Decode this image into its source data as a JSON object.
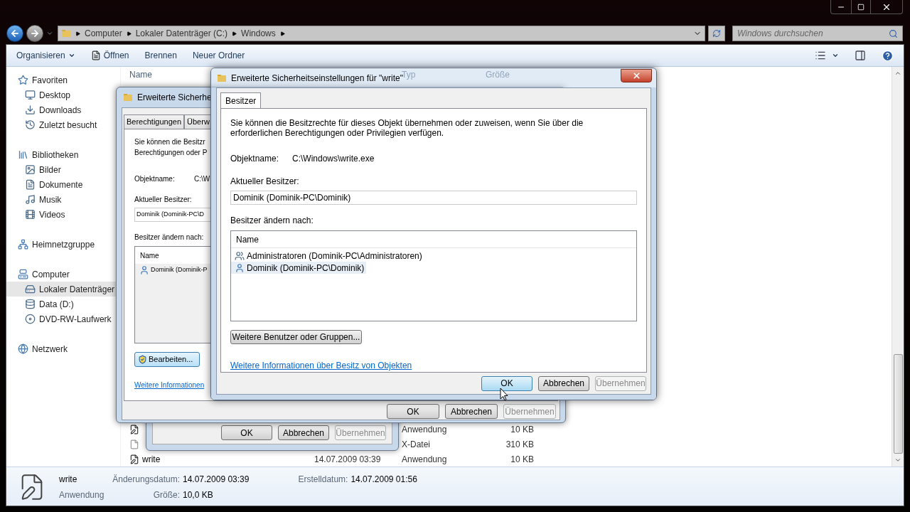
{
  "explorer": {
    "breadcrumb": [
      "Computer",
      "Lokaler Datenträger (C:)",
      "Windows"
    ],
    "search": {
      "placeholder": "Windows durchsuchen"
    },
    "toolbar": [
      {
        "label": "Organisieren",
        "kind": "menu"
      },
      {
        "label": "Öffnen",
        "kind": "icon"
      },
      {
        "label": "Brennen",
        "kind": "plain"
      },
      {
        "label": "Neuer Ordner",
        "kind": "plain"
      }
    ],
    "sidebar": [
      {
        "label": "Favoriten",
        "kind": "star",
        "items": [
          {
            "label": "Desktop",
            "kind": "desktop",
            "selected": false
          },
          {
            "label": "Downloads",
            "kind": "download",
            "selected": false
          },
          {
            "label": "Zuletzt besucht",
            "kind": "recent",
            "selected": false
          }
        ]
      },
      {
        "label": "Bibliotheken",
        "kind": "library",
        "items": [
          {
            "label": "Bilder",
            "kind": "image",
            "selected": false
          },
          {
            "label": "Dokumente",
            "kind": "document",
            "selected": false
          },
          {
            "label": "Musik",
            "kind": "music",
            "selected": false
          },
          {
            "label": "Videos",
            "kind": "video",
            "selected": false
          }
        ]
      },
      {
        "label": "Heimnetzgruppe",
        "kind": "homegroup"
      },
      {
        "label": "Computer",
        "kind": "computer",
        "items": [
          {
            "label": "Lokaler Datenträger",
            "kind": "drive",
            "selected": true
          },
          {
            "label": "Data (D:)",
            "kind": "data",
            "selected": false
          },
          {
            "label": "DVD-RW-Laufwerk",
            "kind": "dvd",
            "selected": false
          }
        ]
      },
      {
        "label": "Netzwerk",
        "kind": "network"
      }
    ],
    "file_list": {
      "columns": [
        "Name",
        "Typ",
        "Größe"
      ],
      "rows": [
        {
          "kind": "app",
          "type": "Anwendung",
          "size": "10 KB"
        },
        {
          "kind": "file",
          "type": "X-Datei",
          "size": "310 KB"
        },
        {
          "kind": "app",
          "name": "write",
          "date": "14.07.2009 03:39",
          "type": "Anwendung",
          "size": "10 KB"
        }
      ]
    },
    "details": {
      "name": "write",
      "type": "Anwendung",
      "columns": [
        [
          {
            "label": "Änderungsdatum:",
            "value": "14.07.2009 03:39"
          },
          {
            "label": "Größe:",
            "value": "10,0 KB"
          }
        ],
        [
          {
            "label": "Erstelldatum:",
            "value": "14.07.2009 01:56"
          }
        ]
      ]
    }
  },
  "dialog_third": {
    "buttons": [
      {
        "label": "OK",
        "default": false,
        "disabled": false
      },
      {
        "label": "Abbrechen",
        "default": false,
        "disabled": false
      },
      {
        "label": "Übernehmen",
        "default": false,
        "disabled": true
      }
    ]
  },
  "dialog_back": {
    "title": "Erweiterte Sicherhe",
    "tabs": [
      {
        "label": "Berechtigungen",
        "selected": false
      },
      {
        "label": "Überw",
        "selected": false
      }
    ],
    "intro": [
      "Sie können die Besitzr",
      "Berechtigungen oder P"
    ],
    "object_label": "Objektname:",
    "object_value": "C:\\W",
    "owner_label": "Aktueller Besitzer:",
    "owner_value": "Dominik (Dominik-PC\\D",
    "change_label": "Besitzer ändern nach:",
    "list": {
      "header": "Name",
      "rows": [
        {
          "label": "Dominik (Dominik-P",
          "kind": "user",
          "selected": false
        }
      ]
    },
    "edit_button": "Bearbeiten...",
    "link": "Weitere Informationen",
    "buttons": [
      {
        "label": "OK",
        "default": false,
        "disabled": false
      },
      {
        "label": "Abbrechen",
        "default": false,
        "disabled": false
      },
      {
        "label": "Übernehmen",
        "default": false,
        "disabled": true
      }
    ]
  },
  "dialog_front": {
    "title": "Erweiterte Sicherheitseinstellungen für \"write\"",
    "tabs": [
      {
        "label": "Besitzer",
        "selected": true
      }
    ],
    "intro": "Sie können die Besitzrechte für dieses Objekt übernehmen oder zuweisen, wenn Sie über die erforderlichen Berechtigungen oder Privilegien verfügen.",
    "object_label": "Objektname:",
    "object_value": "C:\\Windows\\write.exe",
    "owner_label": "Aktueller Besitzer:",
    "owner_value": "Dominik (Dominik-PC\\Dominik)",
    "change_label": "Besitzer ändern nach:",
    "list": {
      "header": "Name",
      "rows": [
        {
          "label": "Administratoren (Dominik-PC\\Administratoren)",
          "kind": "group",
          "selected": false
        },
        {
          "label": "Dominik (Dominik-PC\\Dominik)",
          "kind": "user",
          "selected": true
        }
      ]
    },
    "more_button": "Weitere Benutzer oder Gruppen...",
    "link": "Weitere Informationen über Besitz von Objekten",
    "buttons": [
      {
        "label": "OK",
        "default": true,
        "disabled": false
      },
      {
        "label": "Abbrechen",
        "default": false,
        "disabled": false
      },
      {
        "label": "Übernehmen",
        "default": false,
        "disabled": true
      }
    ]
  }
}
